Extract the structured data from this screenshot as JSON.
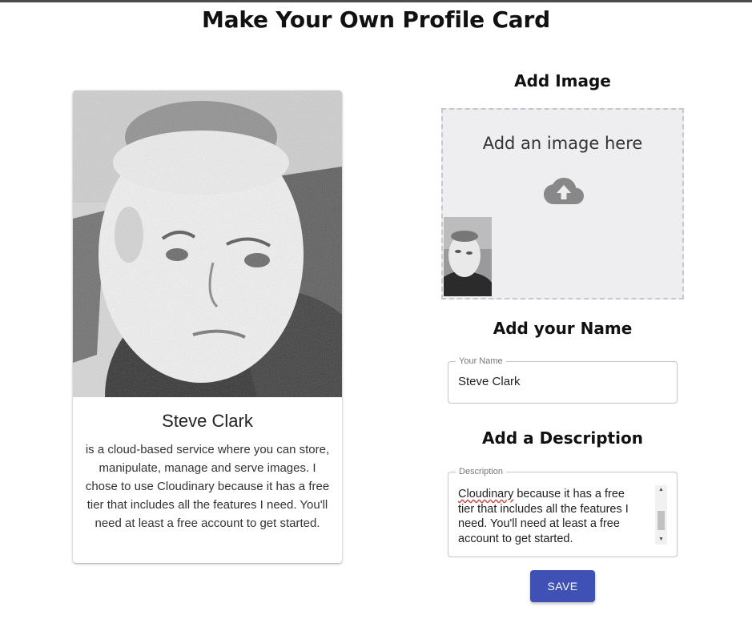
{
  "page": {
    "title": "Make Your Own Profile Card"
  },
  "card": {
    "photo_alt": "Profile photo",
    "name": "Steve Clark",
    "description": "is a cloud-based service where you can store, manipulate, manage and serve images. I chose to use Cloudinary because it has a free tier that includes all the features I need. You'll need at least a free account to get started."
  },
  "image_section": {
    "heading": "Add Image",
    "dropzone_text": "Add an image here",
    "icon": "cloud-upload-icon"
  },
  "name_section": {
    "heading": "Add your Name",
    "field_label": "Your Name",
    "field_value": "Steve Clark"
  },
  "description_section": {
    "heading": "Add a Description",
    "field_label": "Description",
    "visible_first_word": "Cloudinary",
    "visible_rest": " because it has a free\ntier that includes all the features I\nneed. You'll need at least a free\naccount to get started."
  },
  "actions": {
    "save_label": "SAVE"
  },
  "colors": {
    "primary": "#3f51b5",
    "dropzone_bg": "#eeedf0",
    "dropzone_border": "#c9c4cf"
  }
}
